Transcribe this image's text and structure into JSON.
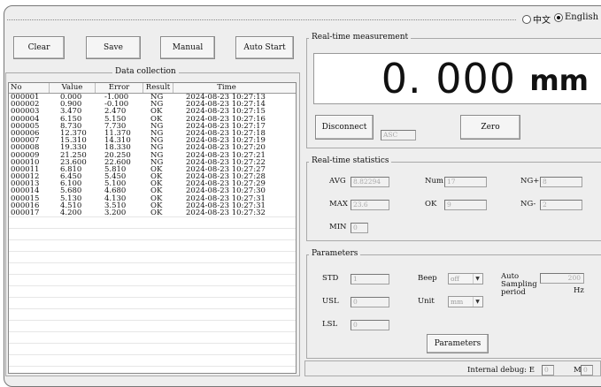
{
  "language": {
    "chinese_label": "中文",
    "english_label": "English",
    "selected": "English"
  },
  "toolbar": {
    "clear_label": "Clear",
    "save_label": "Save",
    "manual_label": "Manual",
    "auto_start_label": "Auto Start"
  },
  "data_collection": {
    "title": "Data collection",
    "columns": [
      "No",
      "Value",
      "Error",
      "Result",
      "Time"
    ],
    "rows": [
      [
        "000001",
        "0.000",
        "-1.000",
        "NG",
        "2024-08-23 10:27:13"
      ],
      [
        "000002",
        "0.900",
        "-0.100",
        "NG",
        "2024-08-23 10:27:14"
      ],
      [
        "000003",
        "3.470",
        "2.470",
        "OK",
        "2024-08-23 10:27:15"
      ],
      [
        "000004",
        "6.150",
        "5.150",
        "OK",
        "2024-08-23 10:27:16"
      ],
      [
        "000005",
        "8.730",
        "7.730",
        "NG",
        "2024-08-23 10:27:17"
      ],
      [
        "000006",
        "12.370",
        "11.370",
        "NG",
        "2024-08-23 10:27:18"
      ],
      [
        "000007",
        "15.310",
        "14.310",
        "NG",
        "2024-08-23 10:27:19"
      ],
      [
        "000008",
        "19.330",
        "18.330",
        "NG",
        "2024-08-23 10:27:20"
      ],
      [
        "000009",
        "21.250",
        "20.250",
        "NG",
        "2024-08-23 10:27:21"
      ],
      [
        "000010",
        "23.600",
        "22.600",
        "NG",
        "2024-08-23 10:27:22"
      ],
      [
        "000011",
        "6.810",
        "5.810",
        "OK",
        "2024-08-23 10:27:27"
      ],
      [
        "000012",
        "6.450",
        "5.450",
        "OK",
        "2024-08-23 10:27:28"
      ],
      [
        "000013",
        "6.100",
        "5.100",
        "OK",
        "2024-08-23 10:27:29"
      ],
      [
        "000014",
        "5.680",
        "4.680",
        "OK",
        "2024-08-23 10:27:30"
      ],
      [
        "000015",
        "5.130",
        "4.130",
        "OK",
        "2024-08-23 10:27:31"
      ],
      [
        "000016",
        "4.510",
        "3.510",
        "OK",
        "2024-08-23 10:27:31"
      ],
      [
        "000017",
        "4.200",
        "3.200",
        "OK",
        "2024-08-23 10:27:32"
      ]
    ]
  },
  "measurement": {
    "title": "Real-time measurement",
    "value": "0. 000",
    "unit": "mm",
    "disconnect_label": "Disconnect",
    "asc_value": "ASC",
    "zero_label": "Zero"
  },
  "statistics": {
    "title": "Real-time statistics",
    "avg_label": "AVG",
    "avg_value": "8.82294",
    "max_label": "MAX",
    "max_value": "23.6",
    "min_label": "MIN",
    "min_value": "0",
    "num_label": "Num",
    "num_value": "17",
    "ok_label": "OK",
    "ok_value": "9",
    "ng_plus_label": "NG+",
    "ng_plus_value": "8",
    "ng_minus_label": "NG-",
    "ng_minus_value": "2"
  },
  "parameters": {
    "title": "Parameters",
    "std_label": "STD",
    "std_value": "1",
    "usl_label": "USL",
    "usl_value": "0",
    "lsl_label": "LSL",
    "lsl_value": "0",
    "beep_label": "Beep",
    "beep_value": "off",
    "unit_label": "Unit",
    "unit_value": "mm",
    "auto_sampling_label": "Auto Sampling period",
    "auto_sampling_value": "200",
    "hz_label": "Hz",
    "parameters_button_label": "Parameters"
  },
  "status": {
    "debug_label": "Internal debug: E",
    "e_value": "0",
    "m_label": "M",
    "m_value": "0"
  }
}
